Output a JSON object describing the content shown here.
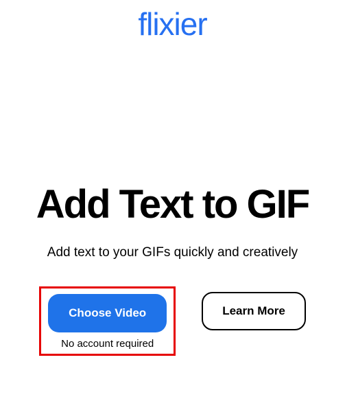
{
  "brand": {
    "name": "flixier"
  },
  "hero": {
    "headline": "Add Text to GIF",
    "subhead": "Add text to your GIFs quickly and creatively"
  },
  "cta": {
    "primary_label": "Choose Video",
    "primary_helper": "No account required",
    "secondary_label": "Learn More"
  }
}
